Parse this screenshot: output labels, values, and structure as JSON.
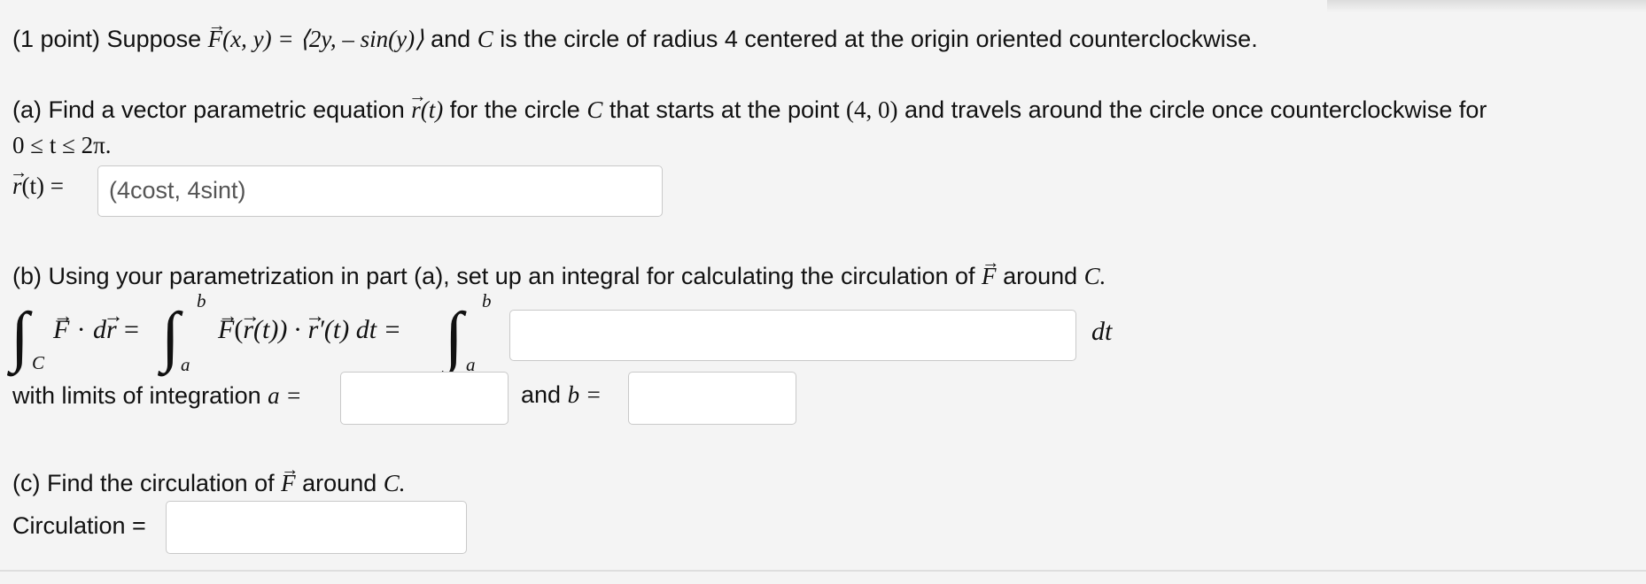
{
  "intro": {
    "prefix": "(1 point) Suppose",
    "field_expr": "(x, y) = ⟨2y, – sin(y)⟩",
    "mid": "and",
    "curve": "C",
    "suffix": "is the circle of radius 4 centered at the origin oriented counterclockwise."
  },
  "part_a": {
    "line1_prefix": "(a) Find a vector parametric equation",
    "line1_rt": "(t)",
    "line1_mid": "for the circle",
    "line1_curve": "C",
    "line1_mid2": "that starts at the point",
    "line1_point": "(4, 0)",
    "line1_suffix": "and travels around the circle once counterclockwise for",
    "line2": "0 ≤ t ≤ 2π.",
    "answer_label_rest": "(t) =",
    "answer_value": "(4cost, 4sint)"
  },
  "part_b": {
    "prompt_prefix": "(b) Using your parametrization in part (a), set up an integral for calculating the circulation of",
    "prompt_suffix": "around",
    "prompt_curve": "C.",
    "integral_lhs_dot": "·",
    "integral_dr": "d",
    "integral_eq": "=",
    "integral_mid": "(t)) ·",
    "integral_mid2": "′(t) dt =",
    "sub_c": "C",
    "lim_a": "a",
    "lim_b": "b",
    "dt_label": "dt",
    "integrand_value": "",
    "limits_label": "with limits of integration",
    "a_label": "a =",
    "a_value": "",
    "and_b_label_pre": "and",
    "b_label": "b =",
    "b_value": ""
  },
  "part_c": {
    "prompt_prefix": "(c) Find the circulation of",
    "prompt_suffix": "around",
    "prompt_curve": "C.",
    "answer_label": "Circulation =",
    "answer_value": ""
  }
}
